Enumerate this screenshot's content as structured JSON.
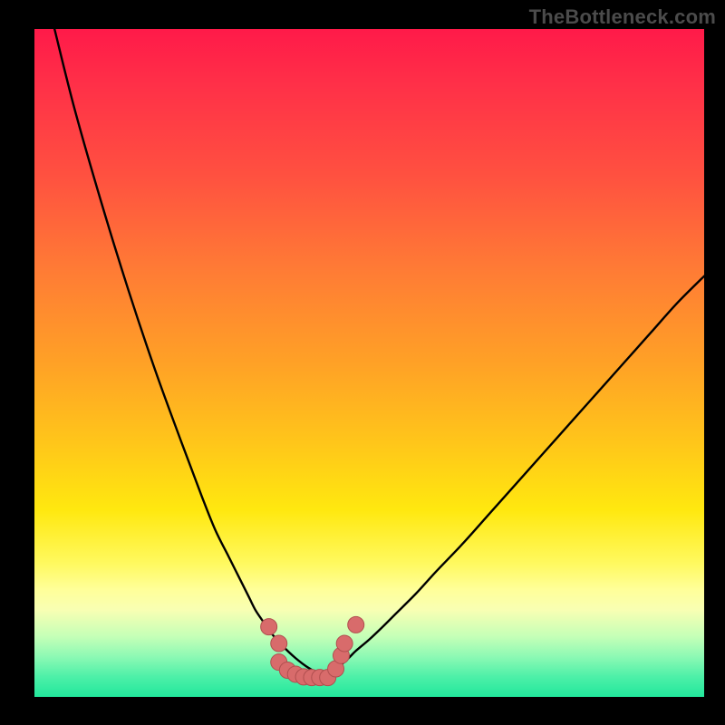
{
  "watermark": "TheBottleneck.com",
  "colors": {
    "background": "#000000",
    "curve": "#000000",
    "marker_fill": "#d86b6b",
    "marker_stroke": "#b04f4f"
  },
  "chart_data": {
    "type": "line",
    "title": "",
    "xlabel": "",
    "ylabel": "",
    "xlim": [
      0,
      100
    ],
    "ylim": [
      0,
      100
    ],
    "grid": false,
    "legend": false,
    "series": [
      {
        "name": "left-curve",
        "x": [
          3,
          6,
          10,
          14,
          18,
          22,
          25,
          27,
          29,
          30.5,
          32,
          33,
          34,
          35,
          36,
          37,
          38,
          39,
          40,
          41,
          42
        ],
        "values": [
          100,
          88,
          74,
          61,
          49,
          38,
          30,
          25,
          21,
          18,
          15,
          13,
          11.5,
          10,
          8.8,
          7.7,
          6.7,
          5.8,
          5,
          4.3,
          3.7
        ]
      },
      {
        "name": "right-curve",
        "x": [
          44,
          45,
          46,
          47,
          48,
          50,
          52,
          54,
          57,
          60,
          64,
          68,
          72,
          76,
          80,
          84,
          88,
          92,
          96,
          100
        ],
        "values": [
          3.5,
          4.2,
          5,
          5.9,
          6.9,
          8.6,
          10.5,
          12.5,
          15.5,
          18.8,
          23,
          27.5,
          32,
          36.5,
          41,
          45.5,
          50,
          54.5,
          59,
          63
        ]
      }
    ],
    "markers": [
      {
        "x": 35.0,
        "y": 10.5
      },
      {
        "x": 36.5,
        "y": 8.0
      },
      {
        "x": 36.5,
        "y": 5.2
      },
      {
        "x": 37.8,
        "y": 4.0
      },
      {
        "x": 39.0,
        "y": 3.4
      },
      {
        "x": 40.2,
        "y": 3.0
      },
      {
        "x": 41.4,
        "y": 2.9
      },
      {
        "x": 42.6,
        "y": 2.9
      },
      {
        "x": 43.8,
        "y": 2.9
      },
      {
        "x": 45.0,
        "y": 4.2
      },
      {
        "x": 45.8,
        "y": 6.2
      },
      {
        "x": 46.3,
        "y": 8.0
      },
      {
        "x": 48.0,
        "y": 10.8
      }
    ]
  }
}
